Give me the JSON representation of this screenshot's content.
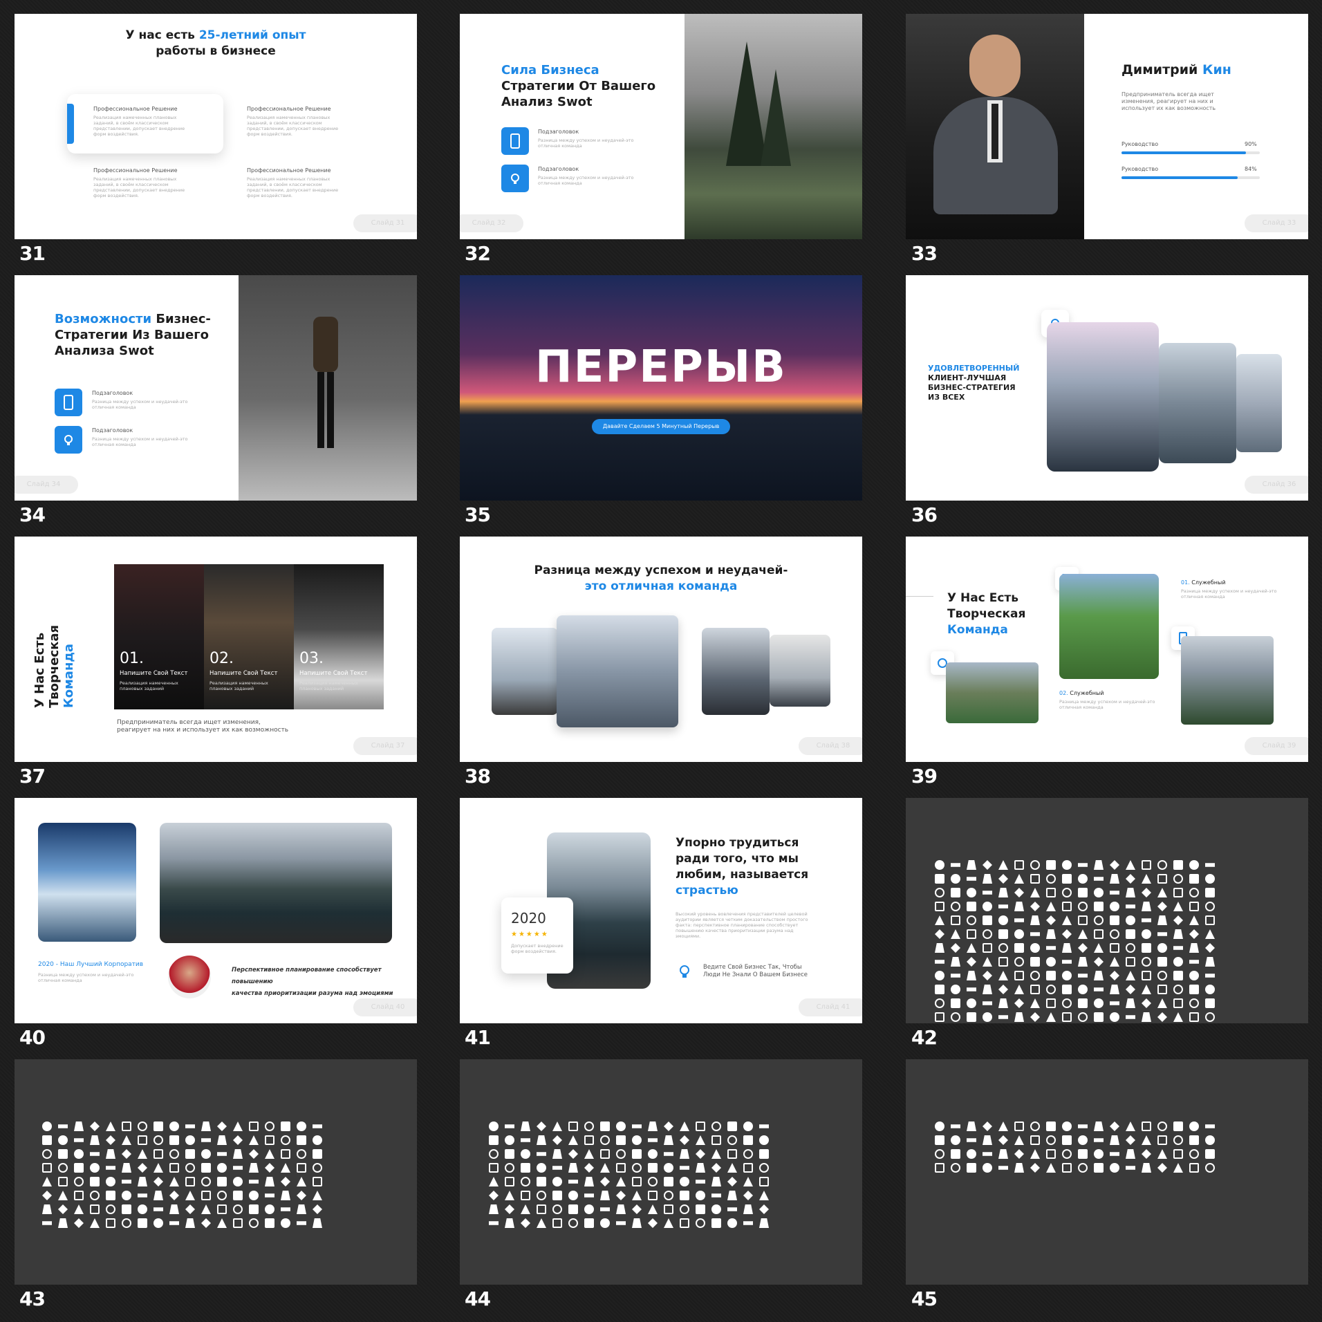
{
  "slides": [
    {
      "num": "31",
      "title_a": "У нас есть ",
      "title_b": "25-летний опыт",
      "title_c": "работы в бизнесе",
      "items": [
        {
          "title": "Профессиональное Решение",
          "text": "Реализация намеченных плановых заданий, в своём классическом представлении, допускает внедрение форм воздействия."
        },
        {
          "title": "Профессиональное Решение",
          "text": "Реализация намеченных плановых заданий, в своём классическом представлении, допускает внедрение форм воздействия."
        },
        {
          "title": "Профессиональное Решение",
          "text": "Реализация намеченных плановых заданий, в своём классическом представлении, допускает внедрение форм воздействия."
        },
        {
          "title": "Профессиональное Решение",
          "text": "Реализация намеченных плановых заданий, в своём классическом представлении, допускает внедрение форм воздействия."
        }
      ],
      "pill": "Слайд 31"
    },
    {
      "num": "32",
      "title_a": "Сила Бизнеса",
      "title_b": "Стратегии От Вашего",
      "title_c": "Анализ Swot",
      "items": [
        {
          "title": "Подзаголовок",
          "text": "Разница между успехом и неудачей-это отличная команда"
        },
        {
          "title": "Подзаголовок",
          "text": "Разница между успехом и неудачей-это отличная команда"
        }
      ],
      "pill": "Слайд 32"
    },
    {
      "num": "33",
      "name_a": "Димитрий ",
      "name_b": "Кин",
      "text": "Предприниматель всегда ищет изменения, реагирует на них и использует их как возможность",
      "skills": [
        {
          "label": "Руководство",
          "value": 90,
          "pct": "90%"
        },
        {
          "label": "Руководство",
          "value": 84,
          "pct": "84%"
        }
      ],
      "pill": "Слайд 33"
    },
    {
      "num": "34",
      "title_a": "Возможности",
      "title_b": " Бизнес-",
      "title_c": "Стратегии Из Вашего",
      "title_d": "Анализа Swot",
      "items": [
        {
          "title": "Подзаголовок",
          "text": "Разница между успехом и неудачей-это отличная команда"
        },
        {
          "title": "Подзаголовок",
          "text": "Разница между успехом и неудачей-это отличная команда"
        }
      ],
      "pill": "Слайд 34"
    },
    {
      "num": "35",
      "title": "ПЕРЕРЫВ",
      "button": "Давайте Сделаем 5 Минутный Перерыв"
    },
    {
      "num": "36",
      "title_a": "УДОВЛЕТВОРЕННЫЙ",
      "title_b": "КЛИЕНТ-ЛУЧШАЯ",
      "title_c": "БИЗНЕС-СТРАТЕГИЯ",
      "title_d": "ИЗ ВСЕХ",
      "pill": "Слайд 36"
    },
    {
      "num": "37",
      "vtitle_a": "У Нас Есть",
      "vtitle_b": "Творческая",
      "vtitle_c": "Команда",
      "cols": [
        {
          "n": "01.",
          "t": "Напишите Свой Текст",
          "s": "Реализация намеченных плановых заданий"
        },
        {
          "n": "02.",
          "t": "Напишите Свой Текст",
          "s": "Реализация намеченных плановых заданий"
        },
        {
          "n": "03.",
          "t": "Напишите Свой Текст",
          "s": "Реализация намеченных плановых заданий"
        }
      ],
      "footer_a": "Предприниматель всегда ищет изменения,",
      "footer_b": "реагирует на них и использует их как возможность",
      "pill": "Слайд 37"
    },
    {
      "num": "38",
      "title_a": "Разница между успехом и неудачей-",
      "title_b": "это отличная команда",
      "pill": "Слайд 38"
    },
    {
      "num": "39",
      "title_a": "У Нас Есть",
      "title_b": "Творческая",
      "title_c": "Команда",
      "s1n": "01.",
      "s1t": "Служебный",
      "s1s": "Разница между успехом и неудачей-это отличная команда",
      "s2n": "02.",
      "s2t": "Служебный",
      "s2s": "Разница между успехом и неудачей-это отличная команда",
      "pill": "Слайд 39"
    },
    {
      "num": "40",
      "caption": "2020 - Наш Лучший Корпоратив",
      "caption_sub": "Разница между успехом и неудачей-это отличная команда",
      "quote_a": "Перспективное планирование способствует повышению",
      "quote_b": "качества приоритизации разума над эмоциями",
      "pill": "Слайд 40"
    },
    {
      "num": "41",
      "year": "2020",
      "stars": "★★★★★",
      "card_text": "Допускает внедрение форм воздействия.",
      "title_a": "Упорно трудиться",
      "title_b": "ради того, что мы",
      "title_c": "любим, называется",
      "title_d": "страстью",
      "text": "Высокий уровень вовлечения представителей целевой аудитории является четким доказательством простого факта: перспективное планирование способствует повышению качества приоритизации разума над эмоциями.",
      "tip_a": "Ведите Свой Бизнес Так, Чтобы",
      "tip_b": "Люди Не Знали О Вашем Бизнесе",
      "pill": "Слайд 41"
    },
    {
      "num": "42"
    },
    {
      "num": "43"
    },
    {
      "num": "44"
    },
    {
      "num": "45"
    }
  ],
  "colors": {
    "accent": "#1e88e5",
    "background": "#1c1c1c",
    "icon_slide": "#3a3a3a"
  }
}
